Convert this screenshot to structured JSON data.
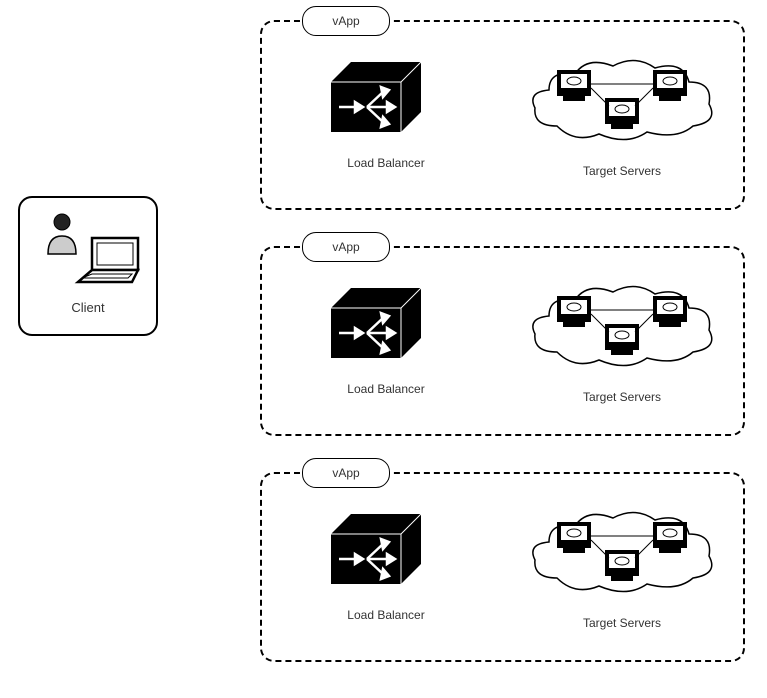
{
  "client": {
    "label": "Client"
  },
  "vapps": [
    {
      "tag": "vApp",
      "lb_label": "Load Balancer",
      "ts_label": "Target Servers"
    },
    {
      "tag": "vApp",
      "lb_label": "Load Balancer",
      "ts_label": "Target Servers"
    },
    {
      "tag": "vApp",
      "lb_label": "Load Balancer",
      "ts_label": "Target Servers"
    }
  ]
}
